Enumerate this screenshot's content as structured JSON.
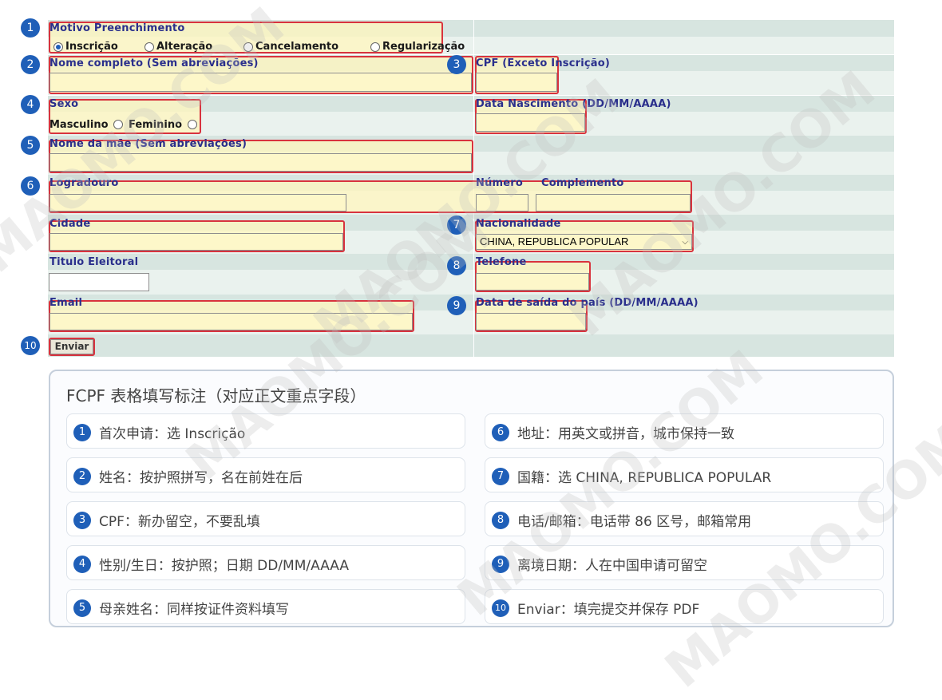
{
  "form": {
    "motivo_label": "Motivo Preenchimento",
    "motivo_options": [
      "Inscrição",
      "Alteração",
      "Cancelamento",
      "Regularização"
    ],
    "motivo_selected": "Inscrição",
    "nome_label": "Nome completo (Sem abreviações)",
    "cpf_label": "CPF (Exceto Inscrição)",
    "sexo_label": "Sexo",
    "sexo_options": [
      "Masculino",
      "Feminino"
    ],
    "nascimento_label": "Data Nascimento (DD/MM/AAAA)",
    "mae_label": "Nome da mãe (Sem abreviações)",
    "logradouro_label": "Logradouro",
    "numero_label": "Número",
    "complemento_label": "Complemento",
    "cidade_label": "Cidade",
    "nacionalidade_label": "Nacionalidade",
    "nacionalidade_value": "CHINA, REPUBLICA POPULAR",
    "titulo_label": "Titulo Eleitoral",
    "telefone_label": "Telefone",
    "email_label": "Email",
    "saida_label": "Data de saída do país (DD/MM/AAAA)",
    "enviar_label": "Enviar"
  },
  "markers": [
    "1",
    "2",
    "3",
    "4",
    "5",
    "6",
    "7",
    "8",
    "9",
    "10"
  ],
  "watermark": "MAOMO.COM",
  "legend": {
    "title": "FCPF 表格填写标注（对应正文重点字段）",
    "items": [
      {
        "num": "1",
        "text": "首次申请：选 Inscrição"
      },
      {
        "num": "2",
        "text": "姓名：按护照拼写，名在前姓在后"
      },
      {
        "num": "3",
        "text": "CPF：新办留空，不要乱填"
      },
      {
        "num": "4",
        "text": "性别/生日：按护照；日期 DD/MM/AAAA"
      },
      {
        "num": "5",
        "text": "母亲姓名：同样按证件资料填写"
      },
      {
        "num": "6",
        "text": "地址：用英文或拼音，城市保持一致"
      },
      {
        "num": "7",
        "text": "国籍：选 CHINA, REPUBLICA POPULAR"
      },
      {
        "num": "8",
        "text": "电话/邮箱：电话带 86 区号，邮箱常用"
      },
      {
        "num": "9",
        "text": "离境日期：人在中国申请可留空"
      },
      {
        "num": "10",
        "text": "Enviar：填完提交并保存 PDF"
      }
    ]
  },
  "colors": {
    "marker_blue": "#1f5fb8",
    "highlight_red": "#d8333e",
    "field_yellow": "#fdf7c9",
    "row_green": "#d7e5e0"
  }
}
